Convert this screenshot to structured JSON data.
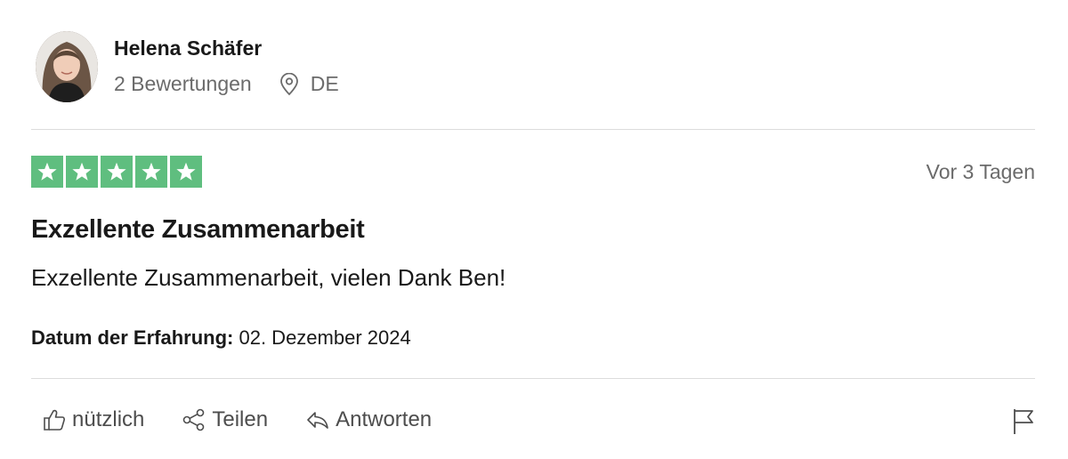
{
  "reviewer": {
    "name": "Helena Schäfer",
    "review_count": "2 Bewertungen",
    "country": "DE"
  },
  "review": {
    "rating": 5,
    "rating_max": 5,
    "relative_date": "Vor 3 Tagen",
    "title": "Exzellente Zusammenarbeit",
    "body": "Exzellente Zusammenarbeit, vielen Dank Ben!",
    "experience_label": "Datum der Erfahrung:",
    "experience_date": "02. Dezember 2024"
  },
  "actions": {
    "useful_label": "nützlich",
    "share_label": "Teilen",
    "reply_label": "Antworten"
  },
  "icons": {
    "location": "location-pin-icon",
    "star": "star-icon",
    "thumbs_up": "thumbs-up-icon",
    "share": "share-icon",
    "reply": "reply-icon",
    "flag": "flag-icon"
  },
  "colors": {
    "star_bg": "#5fbe7f",
    "text_primary": "#191919",
    "text_secondary": "#6b6b6b",
    "divider": "#dcdcdc"
  }
}
